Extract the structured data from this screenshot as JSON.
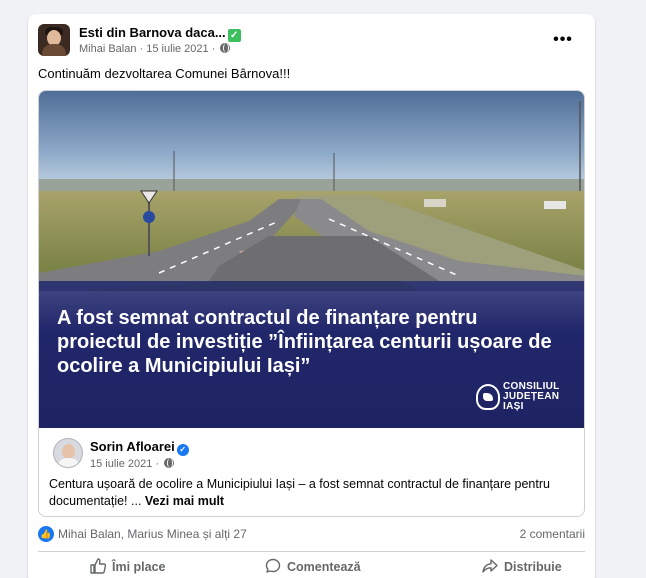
{
  "post": {
    "group_name": "Esti din Barnova daca...",
    "author": "Mihai Balan",
    "date": "15 iulie 2021",
    "separator": " · ",
    "more_label": "•••",
    "text": "Continuăm dezvoltarea Comunei Bârnova!!!"
  },
  "shared": {
    "banner_text": "A fost semnat contractul de finanțare pentru proiectul de investiție ”Înființarea centurii ușoare de ocolire a Municipiului Iași”",
    "logo_line1": "CONSILIUL",
    "logo_line2": "JUDEȚEAN",
    "logo_line3": "IAȘI",
    "inner_author": "Sorin Afloarei",
    "inner_date": "15 iulie 2021",
    "inner_text": "Centura ușoară de ocolire a Municipiului Iași – a fost semnat contractul de finanțare pentru documentație! ...",
    "see_more": "Vezi mai mult"
  },
  "reactions": {
    "names": "Mihai Balan, Marius Minea și alți 27",
    "comments": "2 comentarii"
  },
  "actions": {
    "like": "Îmi place",
    "comment": "Comentează",
    "share": "Distribuie"
  },
  "colors": {
    "accent": "#1877f2",
    "banner": "#1f2461",
    "verified_group": "#3cbf5c"
  },
  "icons": [
    "verified-check-icon",
    "globe-icon",
    "more-icon",
    "like-reaction-icon",
    "thumbs-up-icon",
    "comment-icon",
    "share-icon",
    "council-logo-icon"
  ]
}
